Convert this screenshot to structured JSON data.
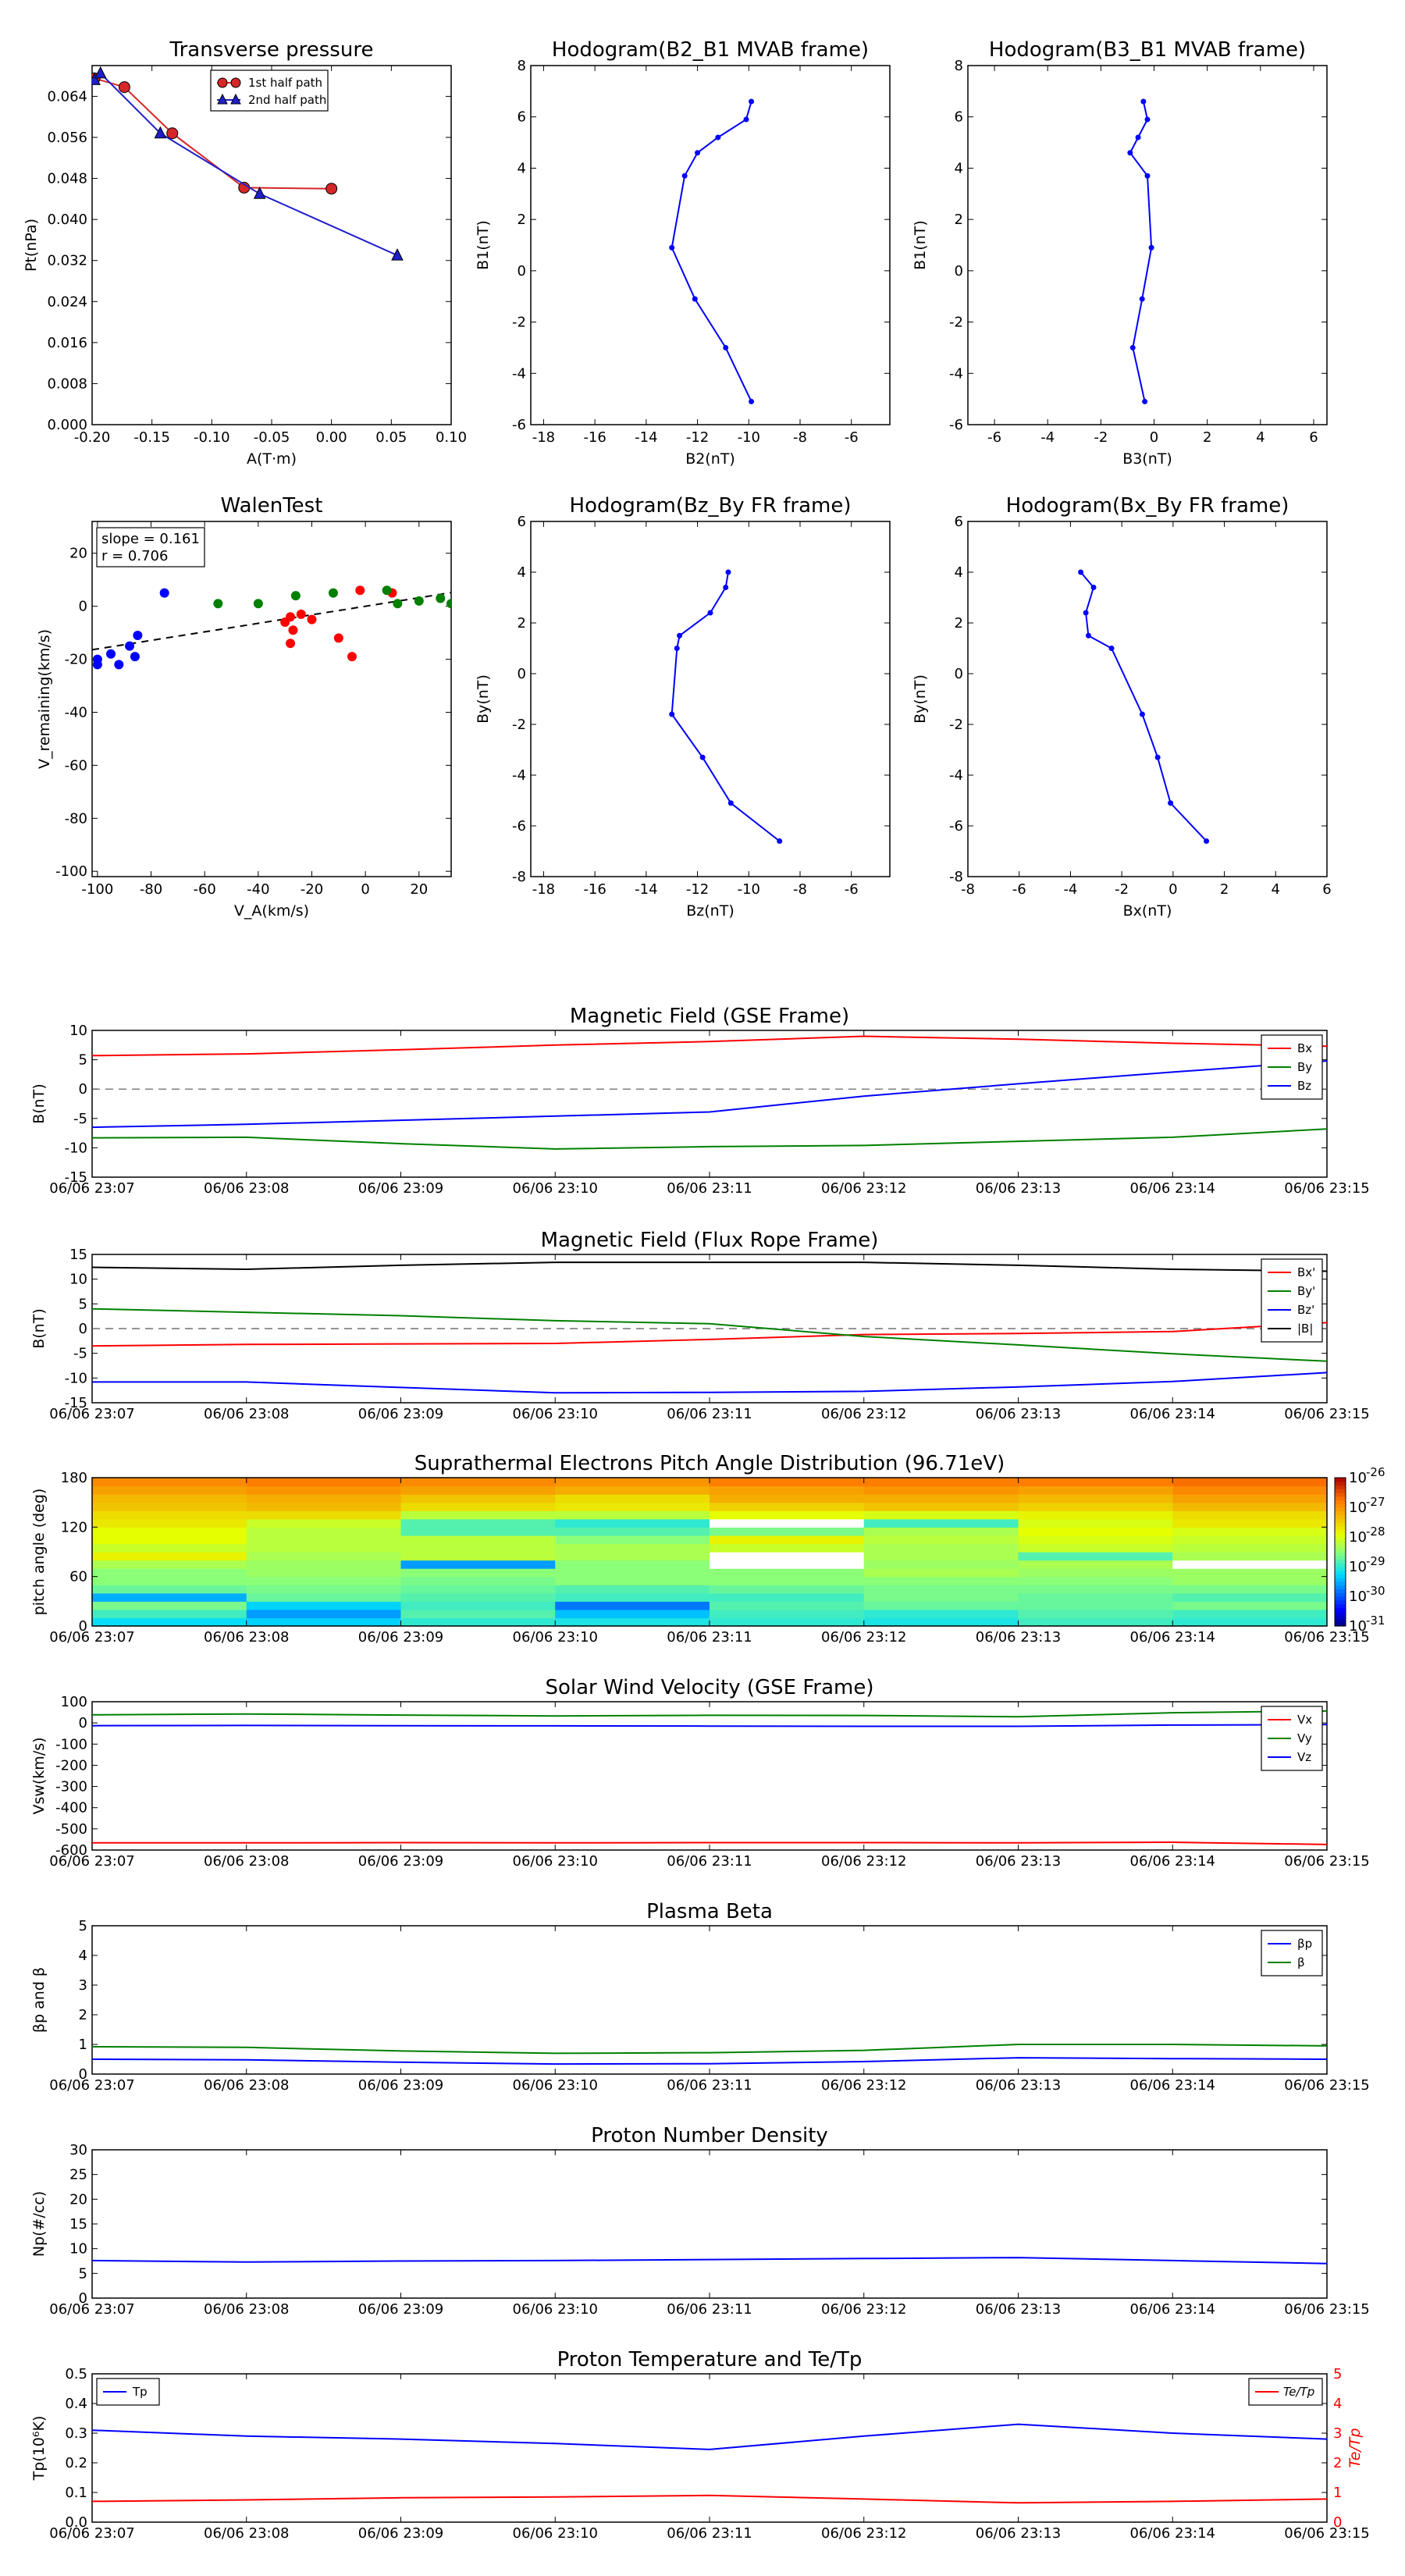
{
  "figure": {
    "time_ticks": [
      "06/06 23:07",
      "06/06 23:08",
      "06/06 23:09",
      "06/06 23:10",
      "06/06 23:11",
      "06/06 23:12",
      "06/06 23:13",
      "06/06 23:14",
      "06/06 23:15"
    ]
  },
  "chart_data": [
    {
      "id": "tp",
      "type": "line",
      "title": "Transverse pressure",
      "xlabel": "A(T·m)",
      "ylabel": "Pt(nPa)",
      "xlim": [
        -0.2,
        0.1
      ],
      "ylim": [
        0.0,
        0.07
      ],
      "xticks": [
        -0.2,
        -0.15,
        -0.1,
        -0.05,
        0.0,
        0.05,
        0.1
      ],
      "yticks": [
        0.0,
        0.008,
        0.016,
        0.024,
        0.032,
        0.04,
        0.048,
        0.056,
        0.064
      ],
      "legend": "top-center",
      "series": [
        {
          "name": "1st half path",
          "color": "#d62728",
          "marker": "circle",
          "x": [
            -0.198,
            -0.173,
            -0.133,
            -0.073,
            0.0
          ],
          "y": [
            0.0675,
            0.0658,
            0.0568,
            0.0462,
            0.046
          ]
        },
        {
          "name": "2nd half path",
          "color": "#1f1fcc",
          "marker": "triangle",
          "x": [
            -0.198,
            -0.193,
            -0.143,
            -0.06,
            0.055
          ],
          "y": [
            0.0672,
            0.0685,
            0.0568,
            0.045,
            0.033
          ]
        }
      ]
    },
    {
      "id": "h1",
      "type": "line",
      "title": "Hodogram(B2_B1 MVAB frame)",
      "xlabel": "B2(nT)",
      "ylabel": "B1(nT)",
      "xlim": [
        -18.5,
        -4.5
      ],
      "ylim": [
        -6,
        8
      ],
      "xticks": [
        -18,
        -16,
        -14,
        -12,
        -10,
        -8,
        -6
      ],
      "yticks": [
        -6,
        -4,
        -2,
        0,
        2,
        4,
        6,
        8
      ],
      "series": [
        {
          "name": "",
          "color": "#0000ff",
          "x": [
            -9.9,
            -10.9,
            -12.1,
            -13.0,
            -12.5,
            -12.0,
            -11.2,
            -10.1,
            -9.9
          ],
          "y": [
            -5.1,
            -3.0,
            -1.1,
            0.9,
            3.7,
            4.6,
            5.2,
            5.9,
            6.6
          ]
        }
      ]
    },
    {
      "id": "h2",
      "type": "line",
      "title": "Hodogram(B3_B1 MVAB frame)",
      "xlabel": "B3(nT)",
      "ylabel": "B1(nT)",
      "xlim": [
        -7,
        6.5
      ],
      "ylim": [
        -6,
        8
      ],
      "xticks": [
        -6,
        -4,
        -2,
        0,
        2,
        4,
        6
      ],
      "yticks": [
        -6,
        -4,
        -2,
        0,
        2,
        4,
        6,
        8
      ],
      "series": [
        {
          "name": "",
          "color": "#0000ff",
          "x": [
            -0.35,
            -0.8,
            -0.45,
            -0.1,
            -0.25,
            -0.9,
            -0.6,
            -0.25,
            -0.4
          ],
          "y": [
            -5.1,
            -3.0,
            -1.1,
            0.9,
            3.7,
            4.6,
            5.2,
            5.9,
            6.6
          ]
        }
      ]
    },
    {
      "id": "walen",
      "type": "scatter",
      "title": "WalenTest",
      "xlabel": "V_A(km/s)",
      "ylabel": "V_remaining(km/s)",
      "xlim": [
        -102,
        32
      ],
      "ylim": [
        -102,
        32
      ],
      "xticks": [
        -100,
        -80,
        -60,
        -40,
        -20,
        0,
        20
      ],
      "yticks": [
        -100,
        -80,
        -60,
        -40,
        -20,
        0,
        20
      ],
      "annotation": [
        "slope = 0.161",
        "r = 0.706"
      ],
      "fit_line": {
        "slope": 0.161,
        "intercept": 0.0,
        "style": "dashed",
        "color": "#000000"
      },
      "series": [
        {
          "name": "",
          "color": "#0000ff",
          "x": [
            -100,
            -100,
            -95,
            -92,
            -88,
            -86,
            -85,
            -75
          ],
          "y": [
            -22,
            -20,
            -18,
            -22,
            -15,
            -19,
            -11,
            5
          ]
        },
        {
          "name": "",
          "color": "#ff0000",
          "x": [
            -30,
            -28,
            -27,
            -28,
            -24,
            -20,
            -10,
            -5,
            -2,
            10
          ],
          "y": [
            -6,
            -4,
            -9,
            -14,
            -3,
            -5,
            -12,
            -19,
            6,
            5
          ]
        },
        {
          "name": "",
          "color": "#008000",
          "x": [
            -55,
            -40,
            -26,
            -12,
            8,
            12,
            20,
            28,
            32
          ],
          "y": [
            1,
            1,
            4,
            5,
            6,
            1,
            2,
            3,
            1
          ]
        }
      ]
    },
    {
      "id": "h3",
      "type": "line",
      "title": "Hodogram(Bz_By FR frame)",
      "xlabel": "Bz(nT)",
      "ylabel": "By(nT)",
      "xlim": [
        -18.5,
        -4.5
      ],
      "ylim": [
        -8,
        6
      ],
      "xticks": [
        -18,
        -16,
        -14,
        -12,
        -10,
        -8,
        -6
      ],
      "yticks": [
        -8,
        -6,
        -4,
        -2,
        0,
        2,
        4,
        6
      ],
      "series": [
        {
          "name": "",
          "color": "#0000ff",
          "x": [
            -8.8,
            -10.7,
            -11.8,
            -13.0,
            -12.8,
            -12.7,
            -11.5,
            -10.9,
            -10.8
          ],
          "y": [
            -6.6,
            -5.1,
            -3.3,
            -1.6,
            1.0,
            1.5,
            2.4,
            3.4,
            4.0
          ]
        }
      ]
    },
    {
      "id": "h4",
      "type": "line",
      "title": "Hodogram(Bx_By FR frame)",
      "xlabel": "Bx(nT)",
      "ylabel": "By(nT)",
      "xlim": [
        -8,
        6
      ],
      "ylim": [
        -8,
        6
      ],
      "xticks": [
        -8,
        -6,
        -4,
        -2,
        0,
        2,
        4,
        6
      ],
      "yticks": [
        -8,
        -6,
        -4,
        -2,
        0,
        2,
        4,
        6
      ],
      "series": [
        {
          "name": "",
          "color": "#0000ff",
          "x": [
            1.3,
            -0.1,
            -0.6,
            -1.2,
            -2.4,
            -3.3,
            -3.4,
            -3.1,
            -3.6
          ],
          "y": [
            -6.6,
            -5.1,
            -3.3,
            -1.6,
            1.0,
            1.5,
            2.4,
            3.4,
            4.0
          ]
        }
      ]
    },
    {
      "id": "mf_gse",
      "type": "line",
      "title": "Magnetic Field (GSE Frame)",
      "ylabel": "B(nT)",
      "ylim": [
        -15,
        10
      ],
      "yticks": [
        -15,
        -10,
        -5,
        0,
        5,
        10
      ],
      "zero_line": true,
      "legend": "top-right",
      "x": [
        0,
        1,
        2,
        3,
        4,
        5,
        6,
        7,
        8
      ],
      "series": [
        {
          "name": "Bx",
          "color": "#ff0000",
          "values": [
            5.7,
            6.0,
            6.7,
            7.5,
            8.1,
            9.0,
            8.5,
            7.8,
            7.3
          ]
        },
        {
          "name": "By",
          "color": "#008000",
          "values": [
            -8.3,
            -8.2,
            -9.3,
            -10.2,
            -9.8,
            -9.6,
            -8.9,
            -8.2,
            -6.8
          ]
        },
        {
          "name": "Bz",
          "color": "#0000ff",
          "values": [
            -6.5,
            -6.0,
            -5.3,
            -4.6,
            -3.9,
            -1.2,
            0.9,
            2.9,
            4.8
          ]
        }
      ]
    },
    {
      "id": "mf_fr",
      "type": "line",
      "title": "Magnetic Field (Flux Rope Frame)",
      "ylabel": "B(nT)",
      "ylim": [
        -15,
        15
      ],
      "yticks": [
        -15,
        -10,
        -5,
        0,
        5,
        10,
        15
      ],
      "zero_line": true,
      "legend": "top-right",
      "x": [
        0,
        1,
        2,
        3,
        4,
        5,
        6,
        7,
        8
      ],
      "series": [
        {
          "name": "Bx'",
          "color": "#ff0000",
          "values": [
            -3.5,
            -3.2,
            -3.1,
            -3.0,
            -2.2,
            -1.2,
            -1.0,
            -0.6,
            1.2
          ]
        },
        {
          "name": "By'",
          "color": "#008000",
          "values": [
            4.0,
            3.3,
            2.6,
            1.6,
            1.0,
            -1.6,
            -3.3,
            -5.1,
            -6.6
          ]
        },
        {
          "name": "Bz'",
          "color": "#0000ff",
          "values": [
            -10.8,
            -10.8,
            -11.9,
            -13.0,
            -12.9,
            -12.7,
            -11.8,
            -10.7,
            -8.9
          ]
        },
        {
          "name": "|B|",
          "color": "#000000",
          "values": [
            12.4,
            12.0,
            12.8,
            13.4,
            13.4,
            13.4,
            12.8,
            12.0,
            11.6
          ]
        }
      ]
    },
    {
      "id": "pad",
      "type": "heatmap",
      "title": "Suprathermal Electrons Pitch Angle Distribution (96.71eV)",
      "ylabel": "pitch angle (deg)",
      "ylim": [
        0,
        180
      ],
      "yticks": [
        0,
        60,
        120,
        180
      ],
      "colorbar_ticks": [
        "10",
        "10",
        "10",
        "10",
        "10",
        "10"
      ],
      "colorbar_exponents": [
        "-26",
        "-27",
        "-28",
        "-29",
        "-30",
        "-31"
      ],
      "log_range": [
        -31,
        -26
      ],
      "bins": 18,
      "rows_low_to_high": [
        [
          -29.2,
          -29.3,
          -29.0,
          -29.1,
          -29.0,
          -29.1,
          -28.9,
          -29.0
        ],
        [
          -28.9,
          -29.6,
          -28.8,
          -29.4,
          -28.9,
          -29.0,
          -28.8,
          -28.9
        ],
        [
          -28.6,
          -29.3,
          -28.9,
          -29.8,
          -28.8,
          -28.7,
          -28.7,
          -28.6
        ],
        [
          -29.5,
          -28.7,
          -28.8,
          -28.9,
          -28.9,
          -28.6,
          -28.7,
          -28.8
        ],
        [
          -28.7,
          -28.6,
          -28.7,
          -28.8,
          -28.7,
          -28.6,
          -28.6,
          -28.6
        ],
        [
          -28.5,
          -28.5,
          -28.6,
          -28.5,
          -28.5,
          -28.5,
          -28.5,
          -28.4
        ],
        [
          -28.5,
          -28.4,
          -28.5,
          -28.5,
          -28.5,
          -28.3,
          -28.4,
          -28.4
        ],
        [
          -28.3,
          -28.4,
          -29.6,
          -28.5,
          null,
          -28.4,
          -28.3,
          null
        ],
        [
          -27.8,
          -28.3,
          -28.2,
          -28.3,
          null,
          -28.3,
          -28.8,
          -28.3
        ],
        [
          -28.1,
          -28.2,
          -28.2,
          -28.3,
          -28.1,
          -28.3,
          -28.1,
          -28.2
        ],
        [
          -27.9,
          -28.2,
          -28.2,
          -28.5,
          -27.8,
          -28.2,
          -28.0,
          -28.1
        ],
        [
          -27.9,
          -28.2,
          -28.8,
          -28.8,
          -28.6,
          -28.3,
          -27.9,
          -28.0
        ],
        [
          -27.7,
          -28.1,
          -28.8,
          -29.0,
          null,
          -28.9,
          -28.0,
          -27.7
        ],
        [
          -27.6,
          -27.6,
          -28.2,
          -28.2,
          -27.9,
          -28.0,
          -27.8,
          -27.6
        ],
        [
          -27.4,
          -27.3,
          -27.6,
          -27.7,
          -27.5,
          -27.4,
          -27.5,
          -27.3
        ],
        [
          -27.3,
          -27.2,
          -27.4,
          -27.6,
          -27.2,
          -27.2,
          -27.3,
          -27.1
        ],
        [
          -27.1,
          -27.0,
          -27.1,
          -27.2,
          -27.1,
          -27.0,
          -27.1,
          -26.9
        ],
        [
          -26.9,
          -26.8,
          -26.9,
          -27.0,
          -26.8,
          -26.8,
          -26.8,
          -26.7
        ]
      ]
    },
    {
      "id": "sw",
      "type": "line",
      "title": "Solar Wind Velocity (GSE Frame)",
      "ylabel": "Vsw(km/s)",
      "ylim": [
        -600,
        100
      ],
      "yticks": [
        -600,
        -500,
        -400,
        -300,
        -200,
        -100,
        0,
        100
      ],
      "legend": "top-right",
      "x": [
        0,
        1,
        2,
        3,
        4,
        5,
        6,
        7,
        8
      ],
      "series": [
        {
          "name": "Vx",
          "color": "#ff0000",
          "values": [
            -566,
            -566,
            -565,
            -566,
            -565,
            -565,
            -566,
            -563,
            -574
          ]
        },
        {
          "name": "Vy",
          "color": "#008000",
          "values": [
            38,
            42,
            37,
            33,
            36,
            35,
            29,
            48,
            56
          ]
        },
        {
          "name": "Vz",
          "color": "#0000ff",
          "values": [
            -13,
            -12,
            -13,
            -14,
            -15,
            -16,
            -16,
            -10,
            -8
          ]
        }
      ]
    },
    {
      "id": "beta",
      "type": "line",
      "title": "Plasma Beta",
      "ylabel": "βp and β",
      "ylim": [
        0,
        5
      ],
      "yticks": [
        0,
        1,
        2,
        3,
        4,
        5
      ],
      "legend": "top-right",
      "x": [
        0,
        1,
        2,
        3,
        4,
        5,
        6,
        7,
        8
      ],
      "series": [
        {
          "name": "βp",
          "color": "#0000ff",
          "values": [
            0.5,
            0.48,
            0.4,
            0.34,
            0.35,
            0.42,
            0.55,
            0.52,
            0.5
          ]
        },
        {
          "name": "β",
          "color": "#008000",
          "values": [
            0.92,
            0.9,
            0.78,
            0.7,
            0.72,
            0.8,
            1.0,
            1.0,
            0.95
          ]
        }
      ]
    },
    {
      "id": "np",
      "type": "line",
      "title": "Proton Number Density",
      "ylabel": "Np(#/cc)",
      "ylim": [
        0,
        30
      ],
      "yticks": [
        0,
        5,
        10,
        15,
        20,
        25,
        30
      ],
      "x": [
        0,
        1,
        2,
        3,
        4,
        5,
        6,
        7,
        8
      ],
      "series": [
        {
          "name": "",
          "color": "#0000ff",
          "values": [
            7.6,
            7.3,
            7.5,
            7.6,
            7.8,
            8.0,
            8.2,
            7.6,
            7.0
          ]
        }
      ]
    },
    {
      "id": "temp",
      "type": "line",
      "title": "Proton Temperature and Te/Tp",
      "ylabel": "Tp(10⁶K)",
      "ylabel_right": "Te/Tp",
      "ylim": [
        0,
        0.5
      ],
      "yticks": [
        0.0,
        0.1,
        0.2,
        0.3,
        0.4,
        0.5
      ],
      "ylim_right": [
        0,
        5
      ],
      "yticks_right": [
        0,
        1,
        2,
        3,
        4,
        5
      ],
      "x": [
        0,
        1,
        2,
        3,
        4,
        5,
        6,
        7,
        8
      ],
      "series": [
        {
          "name": "Tp",
          "color": "#0000ff",
          "axis": "left",
          "values": [
            0.31,
            0.29,
            0.28,
            0.265,
            0.245,
            0.29,
            0.33,
            0.3,
            0.28
          ]
        },
        {
          "name": "Te/Tp",
          "color": "#ff0000",
          "axis": "right",
          "values": [
            0.7,
            0.75,
            0.82,
            0.85,
            0.9,
            0.78,
            0.65,
            0.7,
            0.78
          ]
        }
      ]
    }
  ]
}
